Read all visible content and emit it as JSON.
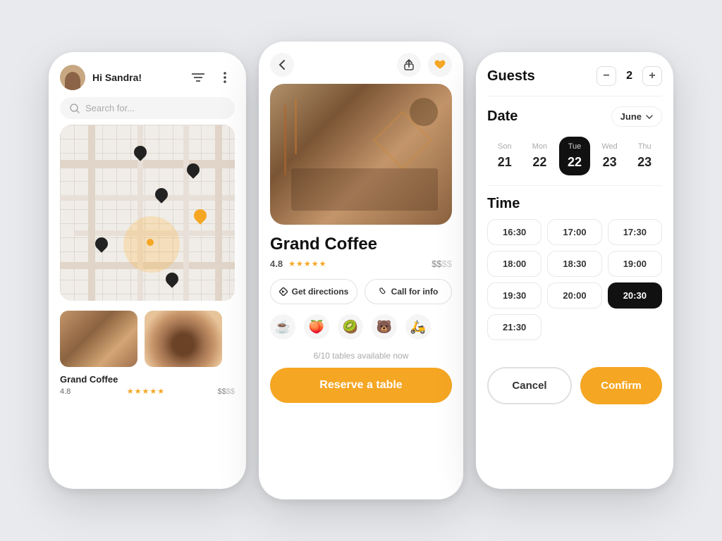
{
  "screen1": {
    "greeting": "Hi Sandra!",
    "search_placeholder": "Search for...",
    "card": {
      "name": "Grand Coffee",
      "rating": "4.8",
      "price": "$$$$"
    }
  },
  "screen2": {
    "restaurant_name": "Grand Coffee",
    "rating": "4.8",
    "price": "$$$$",
    "btn_directions": "Get directions",
    "btn_call": "Call for info",
    "categories": [
      "☕",
      "🍑",
      "🥝",
      "🐻",
      "🛵"
    ],
    "availability": "6/10 tables available now",
    "reserve_btn": "Reserve a table"
  },
  "screen3": {
    "guests_label": "Guests",
    "guests_count": "2",
    "guests_minus": "−",
    "guests_plus": "+",
    "date_label": "Date",
    "month": "June",
    "days": [
      {
        "label": "Son",
        "num": "21"
      },
      {
        "label": "Mon",
        "num": "22"
      },
      {
        "label": "Tue",
        "num": "22",
        "active": true
      },
      {
        "label": "Wed",
        "num": "23"
      },
      {
        "label": "Thu",
        "num": "23"
      }
    ],
    "time_label": "Time",
    "time_slots": [
      {
        "time": "16:30",
        "active": false
      },
      {
        "time": "17:00",
        "active": false
      },
      {
        "time": "17:30",
        "active": false
      },
      {
        "time": "18:00",
        "active": false
      },
      {
        "time": "18:30",
        "active": false
      },
      {
        "time": "19:00",
        "active": false
      },
      {
        "time": "19:30",
        "active": false
      },
      {
        "time": "20:00",
        "active": false
      },
      {
        "time": "20:30",
        "active": true
      },
      {
        "time": "21:30",
        "active": false
      }
    ],
    "cancel_label": "Cancel",
    "confirm_label": "Confirm"
  },
  "colors": {
    "accent": "#F5A623",
    "dark": "#111111",
    "light_bg": "#f5f5f5"
  }
}
